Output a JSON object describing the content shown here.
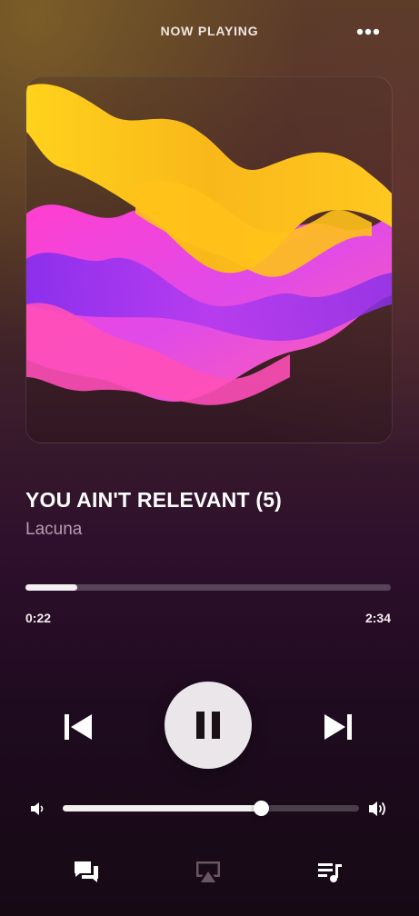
{
  "header": {
    "title": "NOW PLAYING",
    "more_icon": "ellipsis-icon"
  },
  "track": {
    "title": "YOU AIN'T RELEVANT (5)",
    "artist": "Lacuna",
    "elapsed": "0:22",
    "duration": "2:34",
    "progress_fraction": 0.143
  },
  "controls": {
    "previous_icon": "skip-back-icon",
    "play_pause_icon": "pause-icon",
    "next_icon": "skip-forward-icon"
  },
  "volume": {
    "level_fraction": 0.67,
    "low_icon": "speaker-low-icon",
    "high_icon": "speaker-high-icon"
  },
  "bottom_bar": {
    "items": [
      "lyrics-icon",
      "airplay-icon",
      "queue-icon"
    ]
  },
  "colors": {
    "accent": "#ebe6e9",
    "artist_text": "#b99ab3",
    "track_inactive": "rgba(255,255,255,0.22)"
  }
}
